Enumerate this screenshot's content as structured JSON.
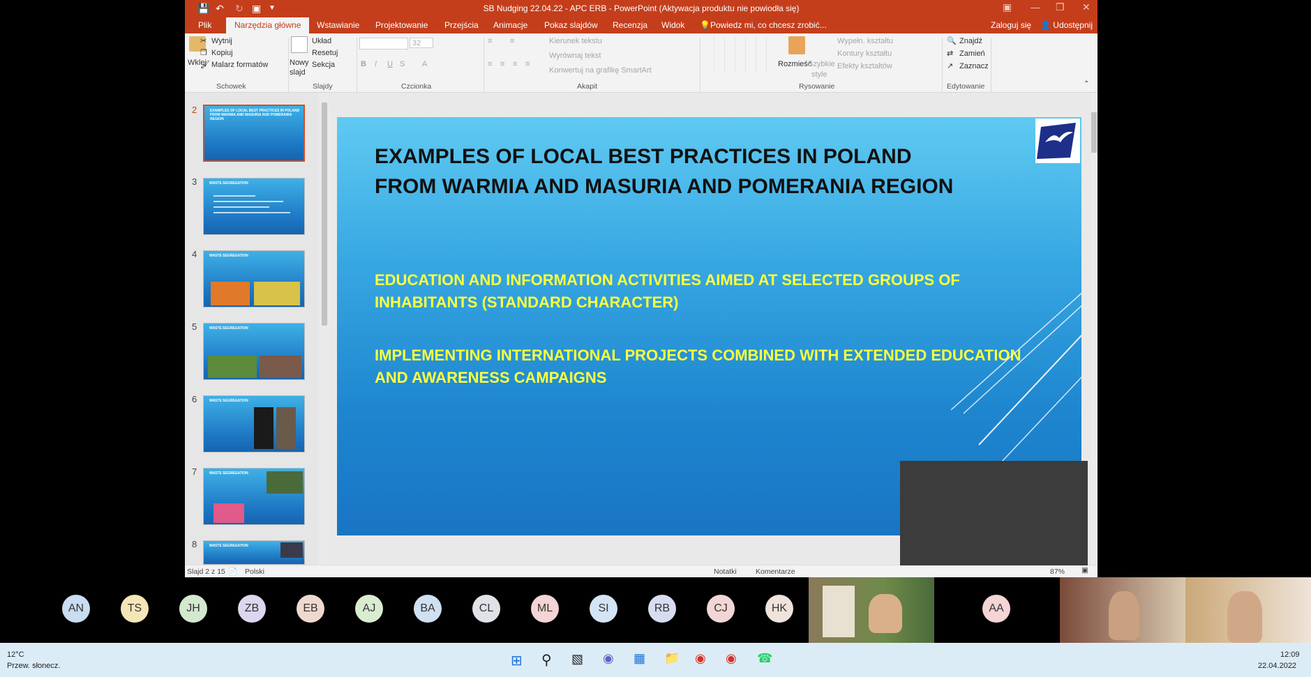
{
  "window": {
    "title": "SB Nudging 22.04.22 - APC ERB - PowerPoint (Aktywacja produktu nie powiodła się)"
  },
  "tabs": [
    "Plik",
    "Narzędzia główne",
    "Wstawianie",
    "Projektowanie",
    "Przejścia",
    "Animacje",
    "Pokaz slajdów",
    "Recenzja",
    "Widok"
  ],
  "tell_me": "Powiedz mi, co chcesz zrobić...",
  "account": {
    "signin": "Zaloguj się",
    "share": "Udostępnij"
  },
  "ribbon": {
    "clipboard": {
      "paste": "Wklej",
      "cut": "Wytnij",
      "copy": "Kopiuj",
      "format_painter": "Malarz formatów",
      "group": "Schowek"
    },
    "slides": {
      "new_slide_1": "Nowy",
      "new_slide_2": "slajd",
      "layout": "Układ",
      "reset": "Resetuj",
      "section": "Sekcja",
      "group": "Slajdy"
    },
    "font": {
      "size": "32",
      "group": "Czcionka"
    },
    "paragraph": {
      "text_direction": "Kierunek tekstu",
      "align_text": "Wyrównaj tekst",
      "smartart": "Konwertuj na grafikę SmartArt",
      "group": "Akapit"
    },
    "drawing": {
      "arrange": "Rozmieść",
      "quick_styles_1": "Szybkie",
      "quick_styles_2": "style",
      "fill": "Wypełn. kształtu",
      "outline": "Kontury kształtu",
      "effects": "Efekty kształtów",
      "group": "Rysowanie"
    },
    "editing": {
      "find": "Znajdź",
      "replace": "Zamień",
      "select": "Zaznacz",
      "group": "Edytowanie"
    }
  },
  "thumbnails": [
    {
      "num": "2",
      "title": "EXAMPLES OF LOCAL BEST PRACTICES IN POLAND FROM WARMIA AND MASURIA AND POMERANIA REGION"
    },
    {
      "num": "3",
      "title": "WASTE SEGREGATION"
    },
    {
      "num": "4",
      "title": "WASTE SEGREGATION"
    },
    {
      "num": "5",
      "title": "WASTE SEGREGATION"
    },
    {
      "num": "6",
      "title": "WASTE SEGREGATION"
    },
    {
      "num": "7",
      "title": "WASTE SEGREGATION"
    },
    {
      "num": "8",
      "title": "WASTE SEGREGATION"
    }
  ],
  "slide": {
    "title": "EXAMPLES OF LOCAL BEST PRACTICES IN POLAND FROM WARMIA AND MASURIA AND POMERANIA REGION",
    "bullet1": "EDUCATION AND INFORMATION ACTIVITIES AIMED AT SELECTED GROUPS OF INHABITANTS (STANDARD CHARACTER)",
    "bullet2": "IMPLEMENTING INTERNATIONAL PROJECTS COMBINED WITH EXTENDED EDUCATION AND AWARENESS CAMPAIGNS"
  },
  "status": {
    "slide": "Slajd 2 z 15",
    "language": "Polski",
    "notes": "Notatki",
    "comments": "Komentarze",
    "zoom": "87%"
  },
  "participants": [
    {
      "initials": "AN",
      "color": "#c9dcf0"
    },
    {
      "initials": "TS",
      "color": "#f5e6b8"
    },
    {
      "initials": "JH",
      "color": "#d4e8d0"
    },
    {
      "initials": "ZB",
      "color": "#ddd6ee"
    },
    {
      "initials": "EB",
      "color": "#efd9cf"
    },
    {
      "initials": "AJ",
      "color": "#d9ecd0"
    },
    {
      "initials": "BA",
      "color": "#cfe0f0"
    },
    {
      "initials": "CL",
      "color": "#dfe3e8"
    },
    {
      "initials": "ML",
      "color": "#f4d4d4"
    },
    {
      "initials": "SI",
      "color": "#d3e4f5"
    },
    {
      "initials": "RB",
      "color": "#d7dcf0"
    },
    {
      "initials": "CJ",
      "color": "#f2d6d6"
    },
    {
      "initials": "HK",
      "color": "#efe3dc"
    },
    {
      "initials": "AA",
      "color": "#f4d4d4"
    }
  ],
  "taskbar": {
    "temp": "12°C",
    "weather": "Przew. słonecz.",
    "time": "12:09",
    "date": "22.04.2022"
  }
}
